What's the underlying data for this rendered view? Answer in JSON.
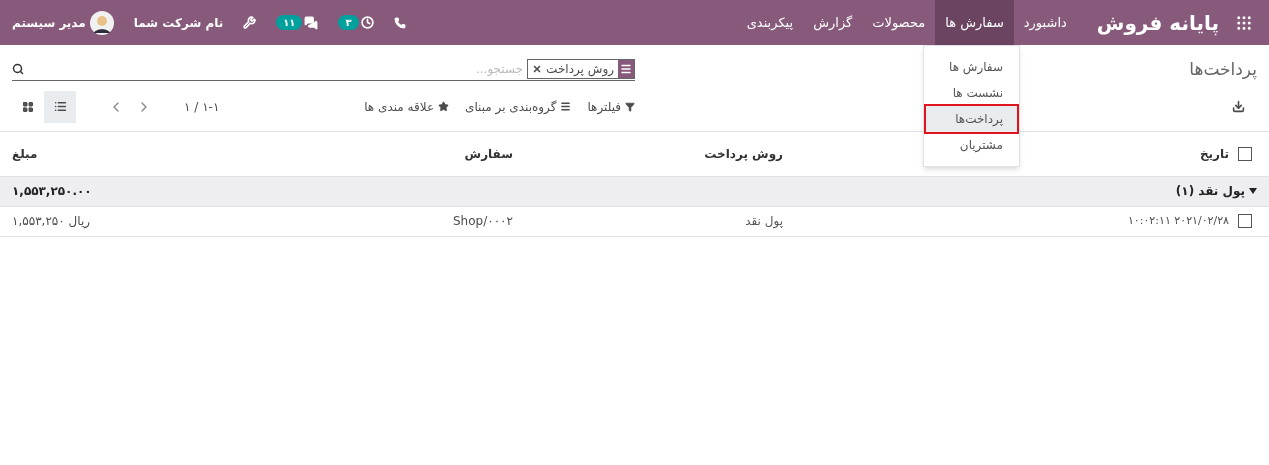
{
  "app_bar": {
    "brand": "پایانه فروش",
    "menus": [
      {
        "label": "داشبورد",
        "selected": false
      },
      {
        "label": "سفارش ها",
        "selected": true
      },
      {
        "label": "محصولات",
        "selected": false
      },
      {
        "label": "گزارش",
        "selected": false
      },
      {
        "label": "پیکربندی",
        "selected": false
      }
    ],
    "dropdown": [
      {
        "label": "سفارش ها",
        "selected": false
      },
      {
        "label": "نشست ها",
        "selected": false
      },
      {
        "label": "پرداخت‌ها",
        "selected": true
      },
      {
        "label": "مشتریان",
        "selected": false
      }
    ],
    "clock_badge": "۳",
    "chat_badge": "۱۱",
    "company": "نام شرکت شما",
    "user": "مدیر سیستم"
  },
  "control_panel": {
    "title": "پرداخت‌ها",
    "facet": "روش پرداخت",
    "search": {
      "placeholder": "جستجو..."
    },
    "filters": "فیلترها",
    "group_by": "گروه‌بندی بر مبنای",
    "favorites": "علاقه مندی ها",
    "pager": "۱-۱ / ۱",
    "views": [
      {
        "kind": "list",
        "selected": true
      },
      {
        "kind": "kanban",
        "selected": false
      }
    ]
  },
  "table": {
    "select_all": {
      "checked": false
    },
    "columns": [
      "تاریخ",
      "روش پرداخت",
      "سفارش",
      "مبلغ"
    ],
    "groups": [
      {
        "label": "پول نقد (۱)",
        "expanded": true,
        "total": "۱,۵۵۳,۲۵۰.۰۰",
        "rows": [
          {
            "checked": false,
            "cells": [
              "۲۰۲۱/۰۲/۲۸ ۱۰:۰۲:۱۱",
              "پول نقد",
              "Shop/۰۰۰۲",
              "۱,۵۵۳,۲۵۰ ریال"
            ]
          }
        ]
      }
    ]
  }
}
